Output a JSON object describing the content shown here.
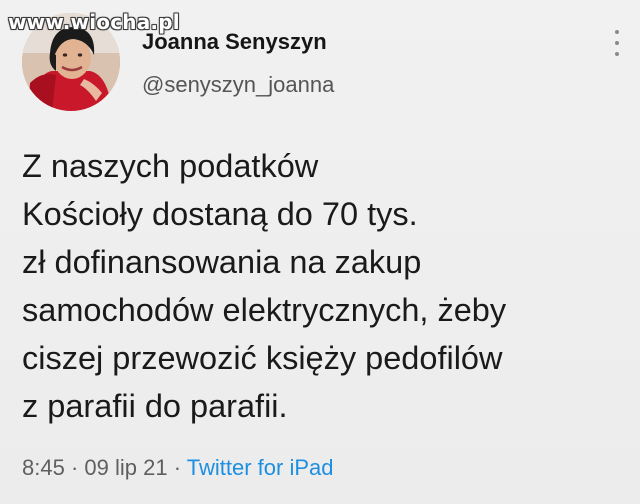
{
  "watermark": "www.wiocha.pl",
  "author": {
    "display_name": "Joanna Senyszyn",
    "handle": "@senyszyn_joanna",
    "avatar_icon": "profile-photo"
  },
  "tweet": {
    "lines": [
      "Z naszych podatków",
      "Kościoły dostaną do 70 tys.",
      "zł dofinansowania na zakup",
      "samochodów elektrycznych, żeby",
      "ciszej przewozić księży pedofilów",
      "z parafii do parafii."
    ]
  },
  "meta": {
    "time": "8:45",
    "separator": "·",
    "date": "09 lip 21",
    "source": "Twitter for iPad"
  },
  "colors": {
    "background": "#eeeeee",
    "link": "#1d8fe0",
    "secondary_text": "#5f5f5f"
  }
}
